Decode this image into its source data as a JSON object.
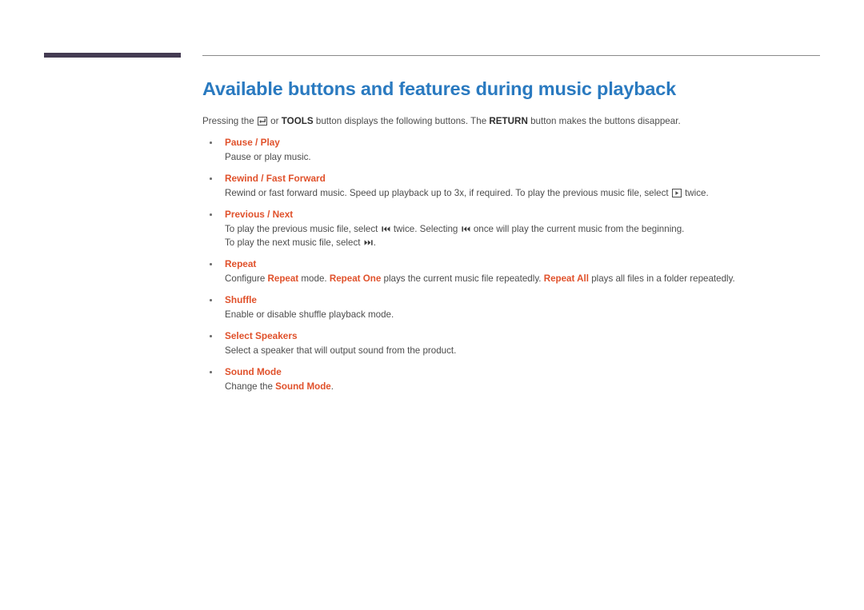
{
  "page": {
    "title": "Available buttons and features during music playback",
    "intro": {
      "part1": "Pressing the ",
      "icon_enter": "enter-key-icon",
      "part2": " or ",
      "bold_tools": "TOOLS",
      "part3": " button displays the following buttons. The ",
      "bold_return": "RETURN",
      "part4": " button makes the buttons disappear."
    }
  },
  "colors": {
    "title": "#2a7ac0",
    "heading": "#e0512b",
    "body": "#4d4d4d",
    "accent_bar": "#443b52",
    "thin_rule": "#8a8a8a"
  },
  "features": [
    {
      "title": "Pause / Play",
      "lines": [
        {
          "segments": [
            {
              "text": "Pause or play music.",
              "bold": false
            }
          ]
        }
      ]
    },
    {
      "title": "Rewind / Fast Forward",
      "lines": [
        {
          "segments": [
            {
              "text": "Rewind or fast forward music. Speed up playback up to 3x, if required. To play the previous music file, select ",
              "bold": false
            },
            {
              "icon": "play-button-icon"
            },
            {
              "text": " twice.",
              "bold": false
            }
          ]
        }
      ]
    },
    {
      "title": "Previous / Next",
      "lines": [
        {
          "segments": [
            {
              "text": "To play the previous music file, select ",
              "bold": false
            },
            {
              "icon": "previous-track-icon"
            },
            {
              "text": " twice. Selecting ",
              "bold": false
            },
            {
              "icon": "previous-track-icon"
            },
            {
              "text": " once will play the current music from the beginning.",
              "bold": false
            }
          ]
        },
        {
          "segments": [
            {
              "text": "To play the next music file, select ",
              "bold": false
            },
            {
              "icon": "next-track-icon"
            },
            {
              "text": ".",
              "bold": false
            }
          ]
        }
      ]
    },
    {
      "title": "Repeat",
      "lines": [
        {
          "segments": [
            {
              "text": "Configure ",
              "bold": false
            },
            {
              "text": "Repeat",
              "bold": true
            },
            {
              "text": " mode. ",
              "bold": false
            },
            {
              "text": "Repeat One",
              "bold": true
            },
            {
              "text": " plays the current music file repeatedly. ",
              "bold": false
            },
            {
              "text": "Repeat All",
              "bold": true
            },
            {
              "text": " plays all files in a folder repeatedly.",
              "bold": false
            }
          ]
        }
      ]
    },
    {
      "title": "Shuffle",
      "lines": [
        {
          "segments": [
            {
              "text": "Enable or disable shuffle playback mode.",
              "bold": false
            }
          ]
        }
      ]
    },
    {
      "title": "Select Speakers",
      "lines": [
        {
          "segments": [
            {
              "text": "Select a speaker that will output sound from the product.",
              "bold": false
            }
          ]
        }
      ]
    },
    {
      "title": "Sound Mode",
      "lines": [
        {
          "segments": [
            {
              "text": "Change the ",
              "bold": false
            },
            {
              "text": "Sound Mode",
              "bold": true
            },
            {
              "text": ".",
              "bold": false
            }
          ]
        }
      ]
    }
  ]
}
